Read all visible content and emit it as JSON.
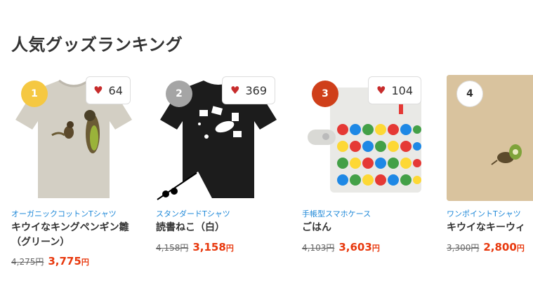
{
  "section_title": "人気グッズランキング",
  "items": [
    {
      "rank": "1",
      "rank_color": "#f5c842",
      "likes": "64",
      "category": "オーガニックコットンTシャツ",
      "title": "キウイなキングペンギン雛（グリーン）",
      "old_price": "4,275円",
      "new_price": "3,775",
      "yen": "円"
    },
    {
      "rank": "2",
      "rank_color": "#a5a5a5",
      "likes": "369",
      "category": "スタンダードTシャツ",
      "title": "読書ねこ（白）",
      "old_price": "4,158円",
      "new_price": "3,158",
      "yen": "円"
    },
    {
      "rank": "3",
      "rank_color": "#cf3f1a",
      "likes": "104",
      "category": "手帳型スマホケース",
      "title": "ごはん",
      "old_price": "4,103円",
      "new_price": "3,603",
      "yen": "円"
    },
    {
      "rank": "4",
      "rank_color": "#ffffff",
      "likes": "",
      "category": "ワンポイントTシャツ",
      "title": "キウイなキーウィ",
      "old_price": "3,300円",
      "new_price": "2,800",
      "yen": "円"
    }
  ],
  "icons": {
    "like": "heart-icon"
  },
  "colors": {
    "accent": "#e8380d",
    "link": "#1e88d8",
    "heart": "#c72c2c"
  }
}
